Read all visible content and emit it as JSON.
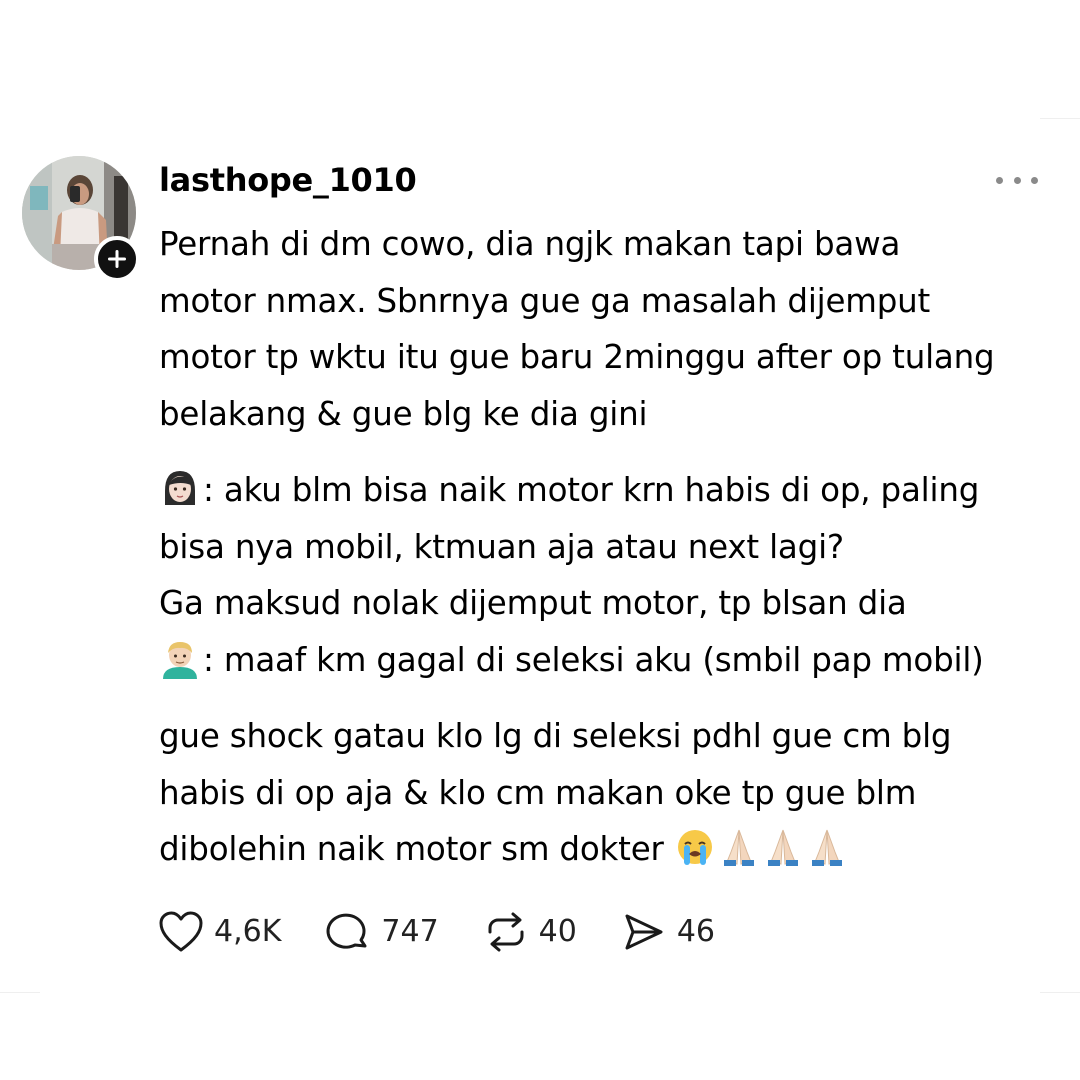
{
  "post": {
    "username": "lasthope_1010",
    "paragraphs": [
      {
        "lines": [
          {
            "emoji": null,
            "text": "Pernah di dm cowo, dia ngjk makan tapi bawa"
          },
          {
            "emoji": null,
            "text": "motor nmax. Sbnrnya gue ga masalah dijemput"
          },
          {
            "emoji": null,
            "text": "motor tp wktu itu gue baru 2minggu after op tulang"
          },
          {
            "emoji": null,
            "text": "belakang & gue blg ke dia gini"
          }
        ]
      },
      {
        "lines": [
          {
            "emoji": "woman-emoji",
            "text": ": aku blm bisa naik motor krn habis di op, paling"
          },
          {
            "emoji": null,
            "text": "bisa nya mobil, ktmuan aja atau next lagi?"
          },
          {
            "emoji": null,
            "text": "Ga maksud nolak dijemput motor, tp blsan dia"
          },
          {
            "emoji": "man-emoji",
            "text": ": maaf km gagal di seleksi aku (smbil pap mobil)"
          }
        ]
      },
      {
        "lines": [
          {
            "emoji": null,
            "text": "gue shock gatau klo lg di seleksi pdhl gue cm blg"
          },
          {
            "emoji": null,
            "text": "habis di op aja & klo cm makan oke tp gue blm"
          },
          {
            "emoji": null,
            "text": "dibolehin naik motor sm dokter ",
            "trailing_emojis": [
              "crying-face-emoji",
              "folded-hands-emoji",
              "folded-hands-emoji",
              "folded-hands-emoji"
            ]
          }
        ]
      }
    ],
    "actions": {
      "like": {
        "icon": "heart-icon",
        "count": "4,6K"
      },
      "reply": {
        "icon": "comment-icon",
        "count": "747"
      },
      "repost": {
        "icon": "repost-icon",
        "count": "40"
      },
      "share": {
        "icon": "send-icon",
        "count": "46"
      }
    }
  },
  "colors": {
    "text": "#000000",
    "muted": "#8a8a8a",
    "background": "#ffffff"
  }
}
